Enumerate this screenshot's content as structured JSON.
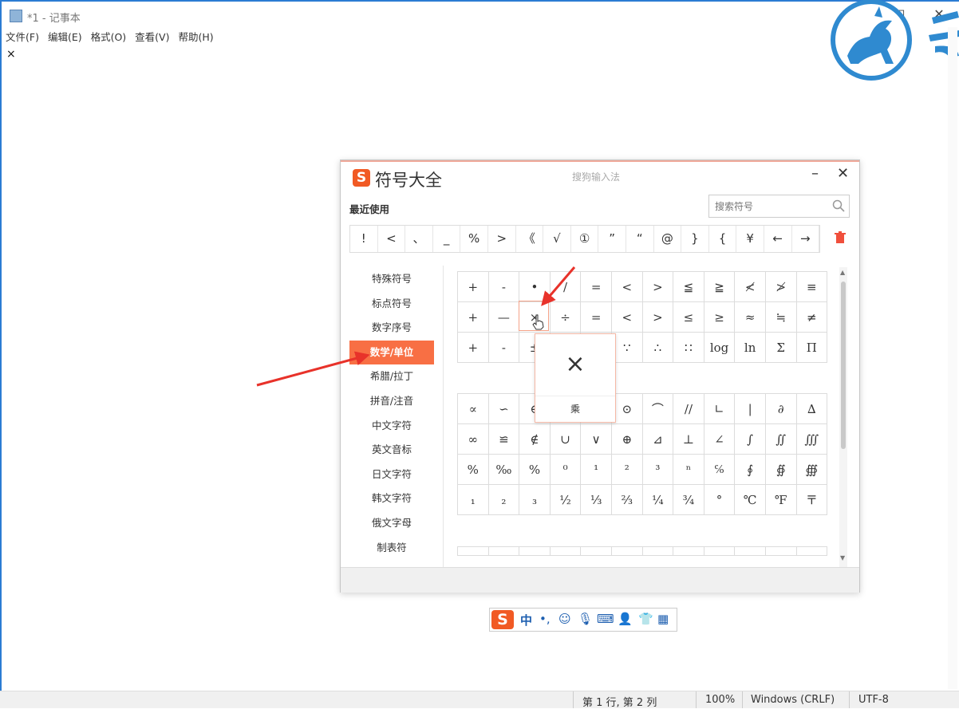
{
  "window": {
    "title": "*1 - 记事本",
    "menu": [
      "文件(F)",
      "编辑(E)",
      "格式(O)",
      "查看(V)",
      "帮助(H)"
    ],
    "editor_text": "×",
    "controls": {
      "minimize": "—",
      "maximize": "□",
      "close": "✕"
    }
  },
  "status_bar": {
    "position": "第 1 行, 第 2 列",
    "zoom": "100%",
    "line_ending": "Windows (CRLF)",
    "encoding": "UTF-8"
  },
  "dialog": {
    "logo": "S",
    "title": "符号大全",
    "subtitle": "搜狗输入法",
    "minimize": "–",
    "close": "✕",
    "recent_label": "最近使用",
    "search_placeholder": "搜索符号",
    "recent": [
      "!",
      "<",
      "、",
      "_",
      "%",
      ">",
      "《",
      "√",
      "①",
      "”",
      "“",
      "@",
      "}",
      "{",
      "¥",
      "←",
      "→"
    ],
    "categories": [
      "特殊符号",
      "标点符号",
      "数字序号",
      "数学/单位",
      "希腊/拉丁",
      "拼音/注音",
      "中文字符",
      "英文音标",
      "日文字符",
      "韩文字符",
      "俄文字母",
      "制表符"
    ],
    "active_category": "数学/单位",
    "grid_top": [
      [
        "+",
        "-",
        "•",
        "/",
        "=",
        "<",
        ">",
        "≦",
        "≧",
        "≮",
        "≯",
        "≡"
      ],
      [
        "+",
        "—",
        "×",
        "÷",
        "=",
        "<",
        ">",
        "≤",
        "≥",
        "≈",
        "≒",
        "≠"
      ],
      [
        "+",
        "-",
        "±",
        "",
        "",
        "∵",
        "∴",
        "∷",
        "log",
        "ln",
        "Σ",
        "Π",
        "∅"
      ]
    ],
    "grid_bottom": [
      [
        "∝",
        "∽",
        "∈",
        "",
        "",
        "⊙",
        "⌒",
        "//",
        "∟",
        "|",
        "∂",
        "∆"
      ],
      [
        "∞",
        "≌",
        "∉",
        "∪",
        "∨",
        "⊕",
        "⊿",
        "⊥",
        "∠",
        "∫",
        "∬",
        "∭"
      ],
      [
        "%",
        "‰",
        "%",
        "⁰",
        "¹",
        "²",
        "³",
        "ⁿ",
        "℅",
        "∮",
        "∯",
        "∰"
      ],
      [
        "₁",
        "₂",
        "₃",
        "½",
        "⅓",
        "⅔",
        "¼",
        "¾",
        "°",
        "℃",
        "℉",
        "〒"
      ]
    ],
    "popup": {
      "symbol": "×",
      "name": "乘"
    }
  },
  "ime_toolbar": {
    "logo": "S",
    "mode": "中",
    "punct": "•,",
    "emoji": "☺",
    "voice": "🎙",
    "keyboard": "⌨",
    "user": "👤",
    "skin": "👕",
    "menu": "▦"
  }
}
